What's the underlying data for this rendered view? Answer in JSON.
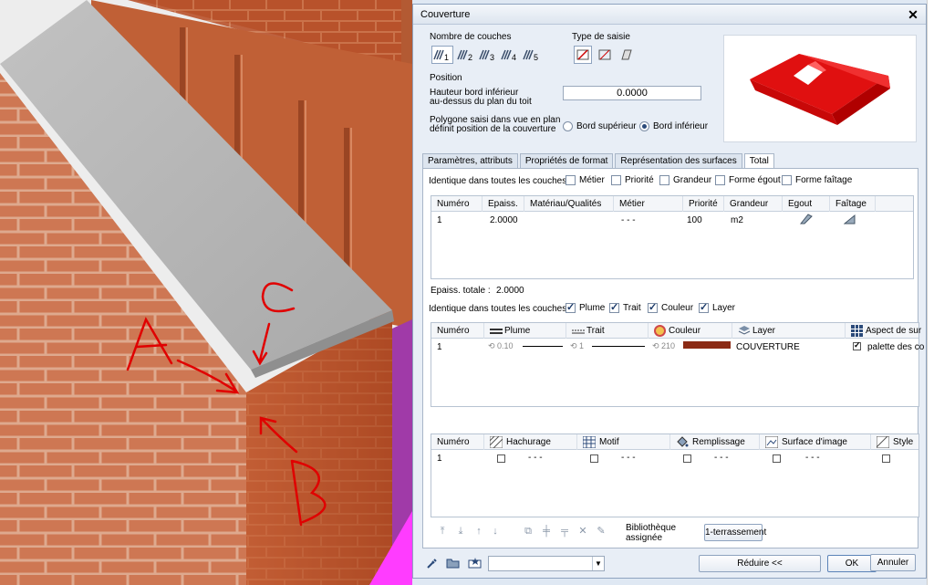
{
  "dialog": {
    "title": "Couverture",
    "close_icon": "close-icon",
    "nombre_couches": {
      "label": "Nombre de couches",
      "options": [
        "1",
        "2",
        "3",
        "4",
        "5"
      ],
      "selected": "1"
    },
    "type_saisie": {
      "label": "Type de saisie",
      "options_icons": [
        "entry-type-a-icon",
        "entry-type-b-icon",
        "entry-type-c-icon"
      ]
    },
    "position": {
      "label": "Position",
      "hauteur_label_1": "Hauteur bord inférieur",
      "hauteur_label_2": "au-dessus du plan du toit",
      "hauteur_value": "0.0000",
      "polygone_label_1": "Polygone saisi dans vue en plan",
      "polygone_label_2": "définit position de la couverture",
      "radio_superieur": "Bord supérieur",
      "radio_inferieur": "Bord inférieur",
      "selected": "inferieur"
    },
    "tabs": [
      "Paramètres, attributs",
      "Propriétés de format",
      "Représentation des surfaces",
      "Total"
    ],
    "active_tab": "Total",
    "identique_label": "Identique dans toutes les couches :",
    "identique_1": [
      "Métier",
      "Priorité",
      "Grandeur",
      "Forme égout",
      "Forme faîtage"
    ],
    "table1": {
      "headers": [
        "Numéro",
        "Epaiss.",
        "Matériau/Qualités",
        "Métier",
        "Priorité",
        "Grandeur",
        "Egout",
        "Faîtage"
      ],
      "row": {
        "numero": "1",
        "epaiss": "2.0000",
        "materiau": "",
        "metier": "- - -",
        "priorite": "100",
        "grandeur": "m2"
      }
    },
    "epaiss_totale_label": "Epaiss. totale :",
    "epaiss_totale_value": "2.0000",
    "identique_2": [
      "Plume",
      "Trait",
      "Couleur",
      "Layer"
    ],
    "table2": {
      "headers": [
        "Numéro",
        "Plume",
        "Trait",
        "Couleur",
        "Layer",
        "Aspect de sur"
      ],
      "row": {
        "numero": "1",
        "plume": "0.10",
        "trait": "1",
        "couleur": "210",
        "layer": "COUVERTURE",
        "aspect": "palette des co"
      },
      "couleur_swatch": "#8b2a14"
    },
    "table3": {
      "headers": [
        "Numéro",
        "Hachurage",
        "Motif",
        "Remplissage",
        "Surface d'image",
        "Style"
      ],
      "row": {
        "numero": "1",
        "hachurage": "- - -",
        "motif": "- - -",
        "remplissage": "- - -",
        "surface": "- - -"
      }
    },
    "bibliotheque_label_1": "Bibliothèque",
    "bibliotheque_label_2": "assignée",
    "bibliotheque_button": "1-terrassement",
    "buttons": {
      "reduire": "Réduire <<",
      "ok": "OK",
      "annuler": "Annuler"
    },
    "bottom_icons": [
      "eyedropper-icon",
      "folder-open-icon",
      "favorites-icon"
    ]
  },
  "viewport": {
    "annotation_letters": [
      "A",
      "B",
      "C"
    ],
    "colors": {
      "brick": "#c2562c",
      "roof": "#b4b4b4",
      "magenta": "#ff33ff",
      "annotation": "#e00000"
    }
  },
  "colors": {
    "accent": "#2b4a7a",
    "roof_preview": "#e01010"
  }
}
